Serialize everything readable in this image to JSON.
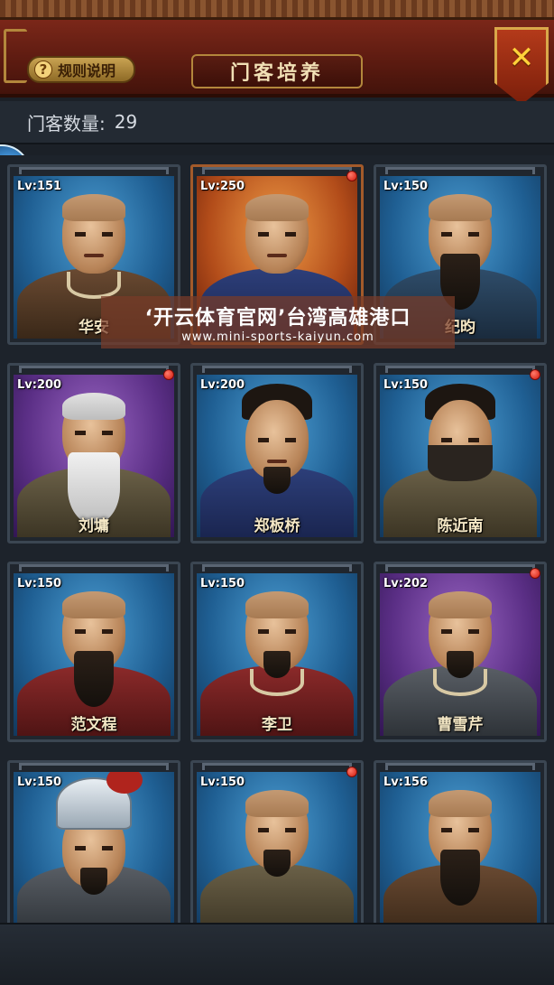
{
  "header": {
    "rules_label": "规则说明",
    "rules_icon": "question-icon",
    "title": "门客培养",
    "close_icon": "close-icon"
  },
  "count": {
    "label": "门客数量:",
    "value": "29"
  },
  "watermark": {
    "title": "‘开云体育官网’台湾高雄港口",
    "url": "www.mini-sports-kaiyun.com"
  },
  "retainers": [
    {
      "lv": "Lv:151",
      "name": "华安",
      "bg": "blue",
      "dot": false
    },
    {
      "lv": "Lv:250",
      "name": "",
      "bg": "orange",
      "dot": true
    },
    {
      "lv": "Lv:150",
      "name": "纪昀",
      "bg": "blue",
      "dot": false
    },
    {
      "lv": "Lv:200",
      "name": "刘墉",
      "bg": "purple",
      "dot": true
    },
    {
      "lv": "Lv:200",
      "name": "郑板桥",
      "bg": "blue",
      "dot": false
    },
    {
      "lv": "Lv:150",
      "name": "陈近南",
      "bg": "blue",
      "dot": true
    },
    {
      "lv": "Lv:150",
      "name": "范文程",
      "bg": "blue",
      "dot": false
    },
    {
      "lv": "Lv:150",
      "name": "李卫",
      "bg": "blue",
      "dot": false
    },
    {
      "lv": "Lv:202",
      "name": "曹雪芹",
      "bg": "purple",
      "dot": true
    },
    {
      "lv": "Lv:150",
      "name": "",
      "bg": "blue",
      "dot": false
    },
    {
      "lv": "Lv:150",
      "name": "",
      "bg": "blue",
      "dot": true
    },
    {
      "lv": "Lv:156",
      "name": "",
      "bg": "blue",
      "dot": false
    }
  ]
}
